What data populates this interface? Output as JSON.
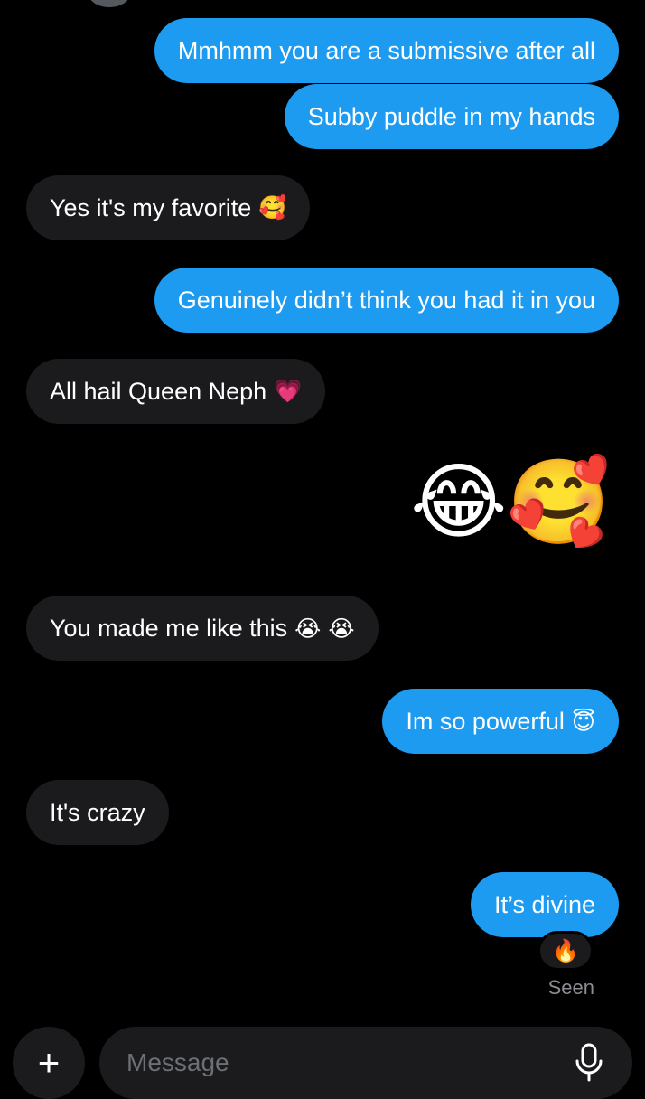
{
  "messages": [
    {
      "text": "Mmhmm you are a submissive after all",
      "emoji": ""
    },
    {
      "text": "Subby puddle in my hands",
      "emoji": ""
    },
    {
      "text": "Yes it's my favorite",
      "emoji": "🥰"
    },
    {
      "text": "Genuinely didn’t think you had it in you",
      "emoji": ""
    },
    {
      "text": "All hail Queen Neph",
      "emoji": "💗"
    },
    {
      "text": "",
      "emoji": "😂🥰"
    },
    {
      "text": "You made me like this",
      "emoji": "😭 😭"
    },
    {
      "text": "Im so powerful",
      "emoji": "😇"
    },
    {
      "text": "It's crazy",
      "emoji": ""
    },
    {
      "text": "It’s divine",
      "emoji": ""
    }
  ],
  "reaction": "🔥",
  "status": "Seen",
  "composer": {
    "plus_label": "+",
    "placeholder": "Message"
  },
  "colors": {
    "outgoing_bubble": "#1d9bf0",
    "incoming_bubble": "#1b1b1d",
    "background": "#000000"
  }
}
